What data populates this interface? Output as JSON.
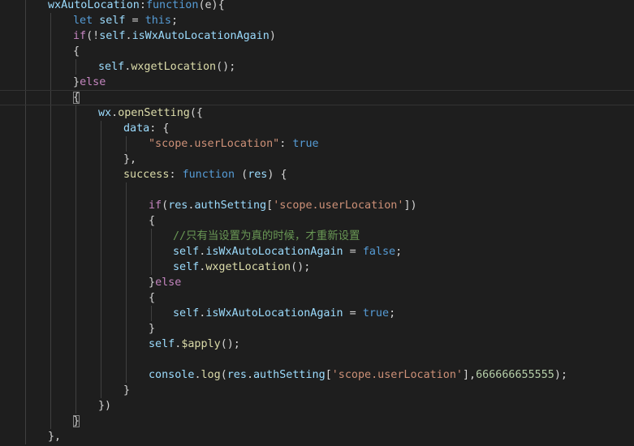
{
  "theme": {
    "background": "#1e1e1e",
    "colors": {
      "prop": "#9cdcfe",
      "keyword": "#569cd6",
      "control": "#c586c0",
      "func": "#dcdcaa",
      "string": "#ce9178",
      "comment": "#6a9955",
      "number": "#b5cea8",
      "punct": "#d4d4d4",
      "brace": "#ffd700"
    }
  },
  "editor": {
    "language": "javascript",
    "lines": [
      [
        [
          "prop",
          "wxAutoLocation"
        ],
        [
          "punct",
          ":"
        ],
        [
          "keyword",
          "function"
        ],
        [
          "punct",
          "(e){"
        ]
      ],
      [
        [
          "keyword",
          "let"
        ],
        [
          "punct",
          " "
        ],
        [
          "prop",
          "self"
        ],
        [
          "punct",
          " = "
        ],
        [
          "keyword",
          "this"
        ],
        [
          "punct",
          ";"
        ]
      ],
      [
        [
          "control",
          "if"
        ],
        [
          "punct",
          "(!"
        ],
        [
          "prop",
          "self"
        ],
        [
          "punct",
          "."
        ],
        [
          "prop",
          "isWxAutoLocationAgain"
        ],
        [
          "punct",
          ")"
        ]
      ],
      [
        [
          "punct",
          "{"
        ]
      ],
      [
        [
          "prop",
          "self"
        ],
        [
          "punct",
          "."
        ],
        [
          "func",
          "wxgetLocation"
        ],
        [
          "punct",
          "();"
        ]
      ],
      [
        [
          "punct",
          "}"
        ],
        [
          "control",
          "else"
        ]
      ],
      [
        [
          "brace",
          "{"
        ]
      ],
      [
        [
          "prop",
          "wx"
        ],
        [
          "punct",
          "."
        ],
        [
          "func",
          "openSetting"
        ],
        [
          "punct",
          "({"
        ]
      ],
      [
        [
          "prop",
          "data"
        ],
        [
          "punct",
          ": {"
        ]
      ],
      [
        [
          "string",
          "\"scope.userLocation\""
        ],
        [
          "punct",
          ": "
        ],
        [
          "keyword",
          "true"
        ]
      ],
      [
        [
          "punct",
          "},"
        ]
      ],
      [
        [
          "func",
          "success"
        ],
        [
          "punct",
          ": "
        ],
        [
          "keyword",
          "function"
        ],
        [
          "punct",
          " ("
        ],
        [
          "prop",
          "res"
        ],
        [
          "punct",
          ") {"
        ]
      ],
      [],
      [
        [
          "control",
          "if"
        ],
        [
          "punct",
          "("
        ],
        [
          "prop",
          "res"
        ],
        [
          "punct",
          "."
        ],
        [
          "prop",
          "authSetting"
        ],
        [
          "punct",
          "["
        ],
        [
          "string",
          "'scope.userLocation'"
        ],
        [
          "punct",
          "])"
        ]
      ],
      [
        [
          "punct",
          "{"
        ]
      ],
      [
        [
          "comment",
          "//只有当设置为真的时候，才重新设置"
        ]
      ],
      [
        [
          "prop",
          "self"
        ],
        [
          "punct",
          "."
        ],
        [
          "prop",
          "isWxAutoLocationAgain"
        ],
        [
          "punct",
          " = "
        ],
        [
          "keyword",
          "false"
        ],
        [
          "punct",
          ";"
        ]
      ],
      [
        [
          "prop",
          "self"
        ],
        [
          "punct",
          "."
        ],
        [
          "func",
          "wxgetLocation"
        ],
        [
          "punct",
          "();"
        ]
      ],
      [
        [
          "punct",
          "}"
        ],
        [
          "control",
          "else"
        ]
      ],
      [
        [
          "punct",
          "{"
        ]
      ],
      [
        [
          "prop",
          "self"
        ],
        [
          "punct",
          "."
        ],
        [
          "prop",
          "isWxAutoLocationAgain"
        ],
        [
          "punct",
          " = "
        ],
        [
          "keyword",
          "true"
        ],
        [
          "punct",
          ";"
        ]
      ],
      [
        [
          "punct",
          "}"
        ]
      ],
      [
        [
          "prop",
          "self"
        ],
        [
          "punct",
          "."
        ],
        [
          "func",
          "$apply"
        ],
        [
          "punct",
          "();"
        ]
      ],
      [],
      [
        [
          "prop",
          "console"
        ],
        [
          "punct",
          "."
        ],
        [
          "func",
          "log"
        ],
        [
          "punct",
          "("
        ],
        [
          "prop",
          "res"
        ],
        [
          "punct",
          "."
        ],
        [
          "prop",
          "authSetting"
        ],
        [
          "punct",
          "["
        ],
        [
          "string",
          "'scope.userLocation'"
        ],
        [
          "punct",
          "],"
        ],
        [
          "number",
          "666666655555"
        ],
        [
          "punct",
          ");"
        ]
      ],
      [
        [
          "punct",
          "}"
        ]
      ],
      [
        [
          "punct",
          "})"
        ]
      ],
      [
        [
          "brace",
          "}"
        ]
      ],
      [
        [
          "punct",
          "},"
        ]
      ]
    ]
  }
}
